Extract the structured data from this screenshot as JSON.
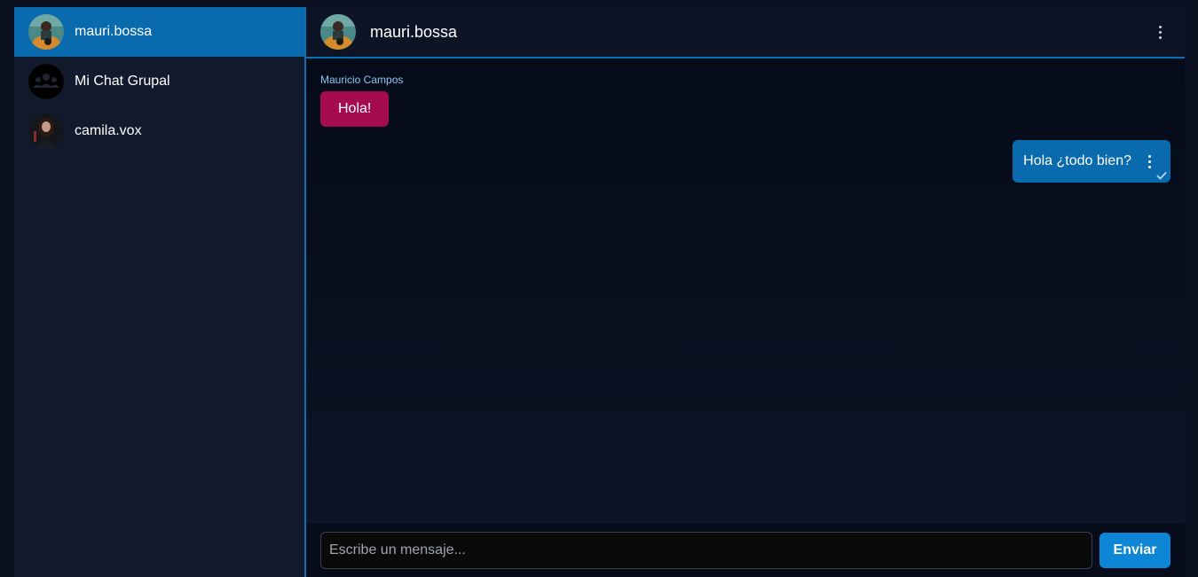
{
  "sidebar": {
    "chats": [
      {
        "name": "mauri.bossa",
        "avatar_icon": "guitar-player-avatar",
        "active": true
      },
      {
        "name": "Mi Chat Grupal",
        "avatar_icon": "group-avatar",
        "active": false
      },
      {
        "name": "camila.vox",
        "avatar_icon": "woman-avatar",
        "active": false
      }
    ]
  },
  "header": {
    "title": "mauri.bossa",
    "menu_icon": "kebab-menu-icon"
  },
  "messages": [
    {
      "sender": "Mauricio Campos",
      "text": "Hola!",
      "direction": "incoming"
    },
    {
      "text": "Hola ¿todo bien?",
      "direction": "outgoing",
      "status": "sent",
      "menu_icon": "kebab-menu-icon",
      "status_icon": "check-icon"
    }
  ],
  "composer": {
    "placeholder": "Escribe un mensaje...",
    "value": "",
    "send_label": "Enviar"
  },
  "colors": {
    "accent": "#0a6aae",
    "incoming_bubble": "#a40c4f",
    "send_button": "#0d86d6",
    "sender_name": "#8ec8f4"
  }
}
